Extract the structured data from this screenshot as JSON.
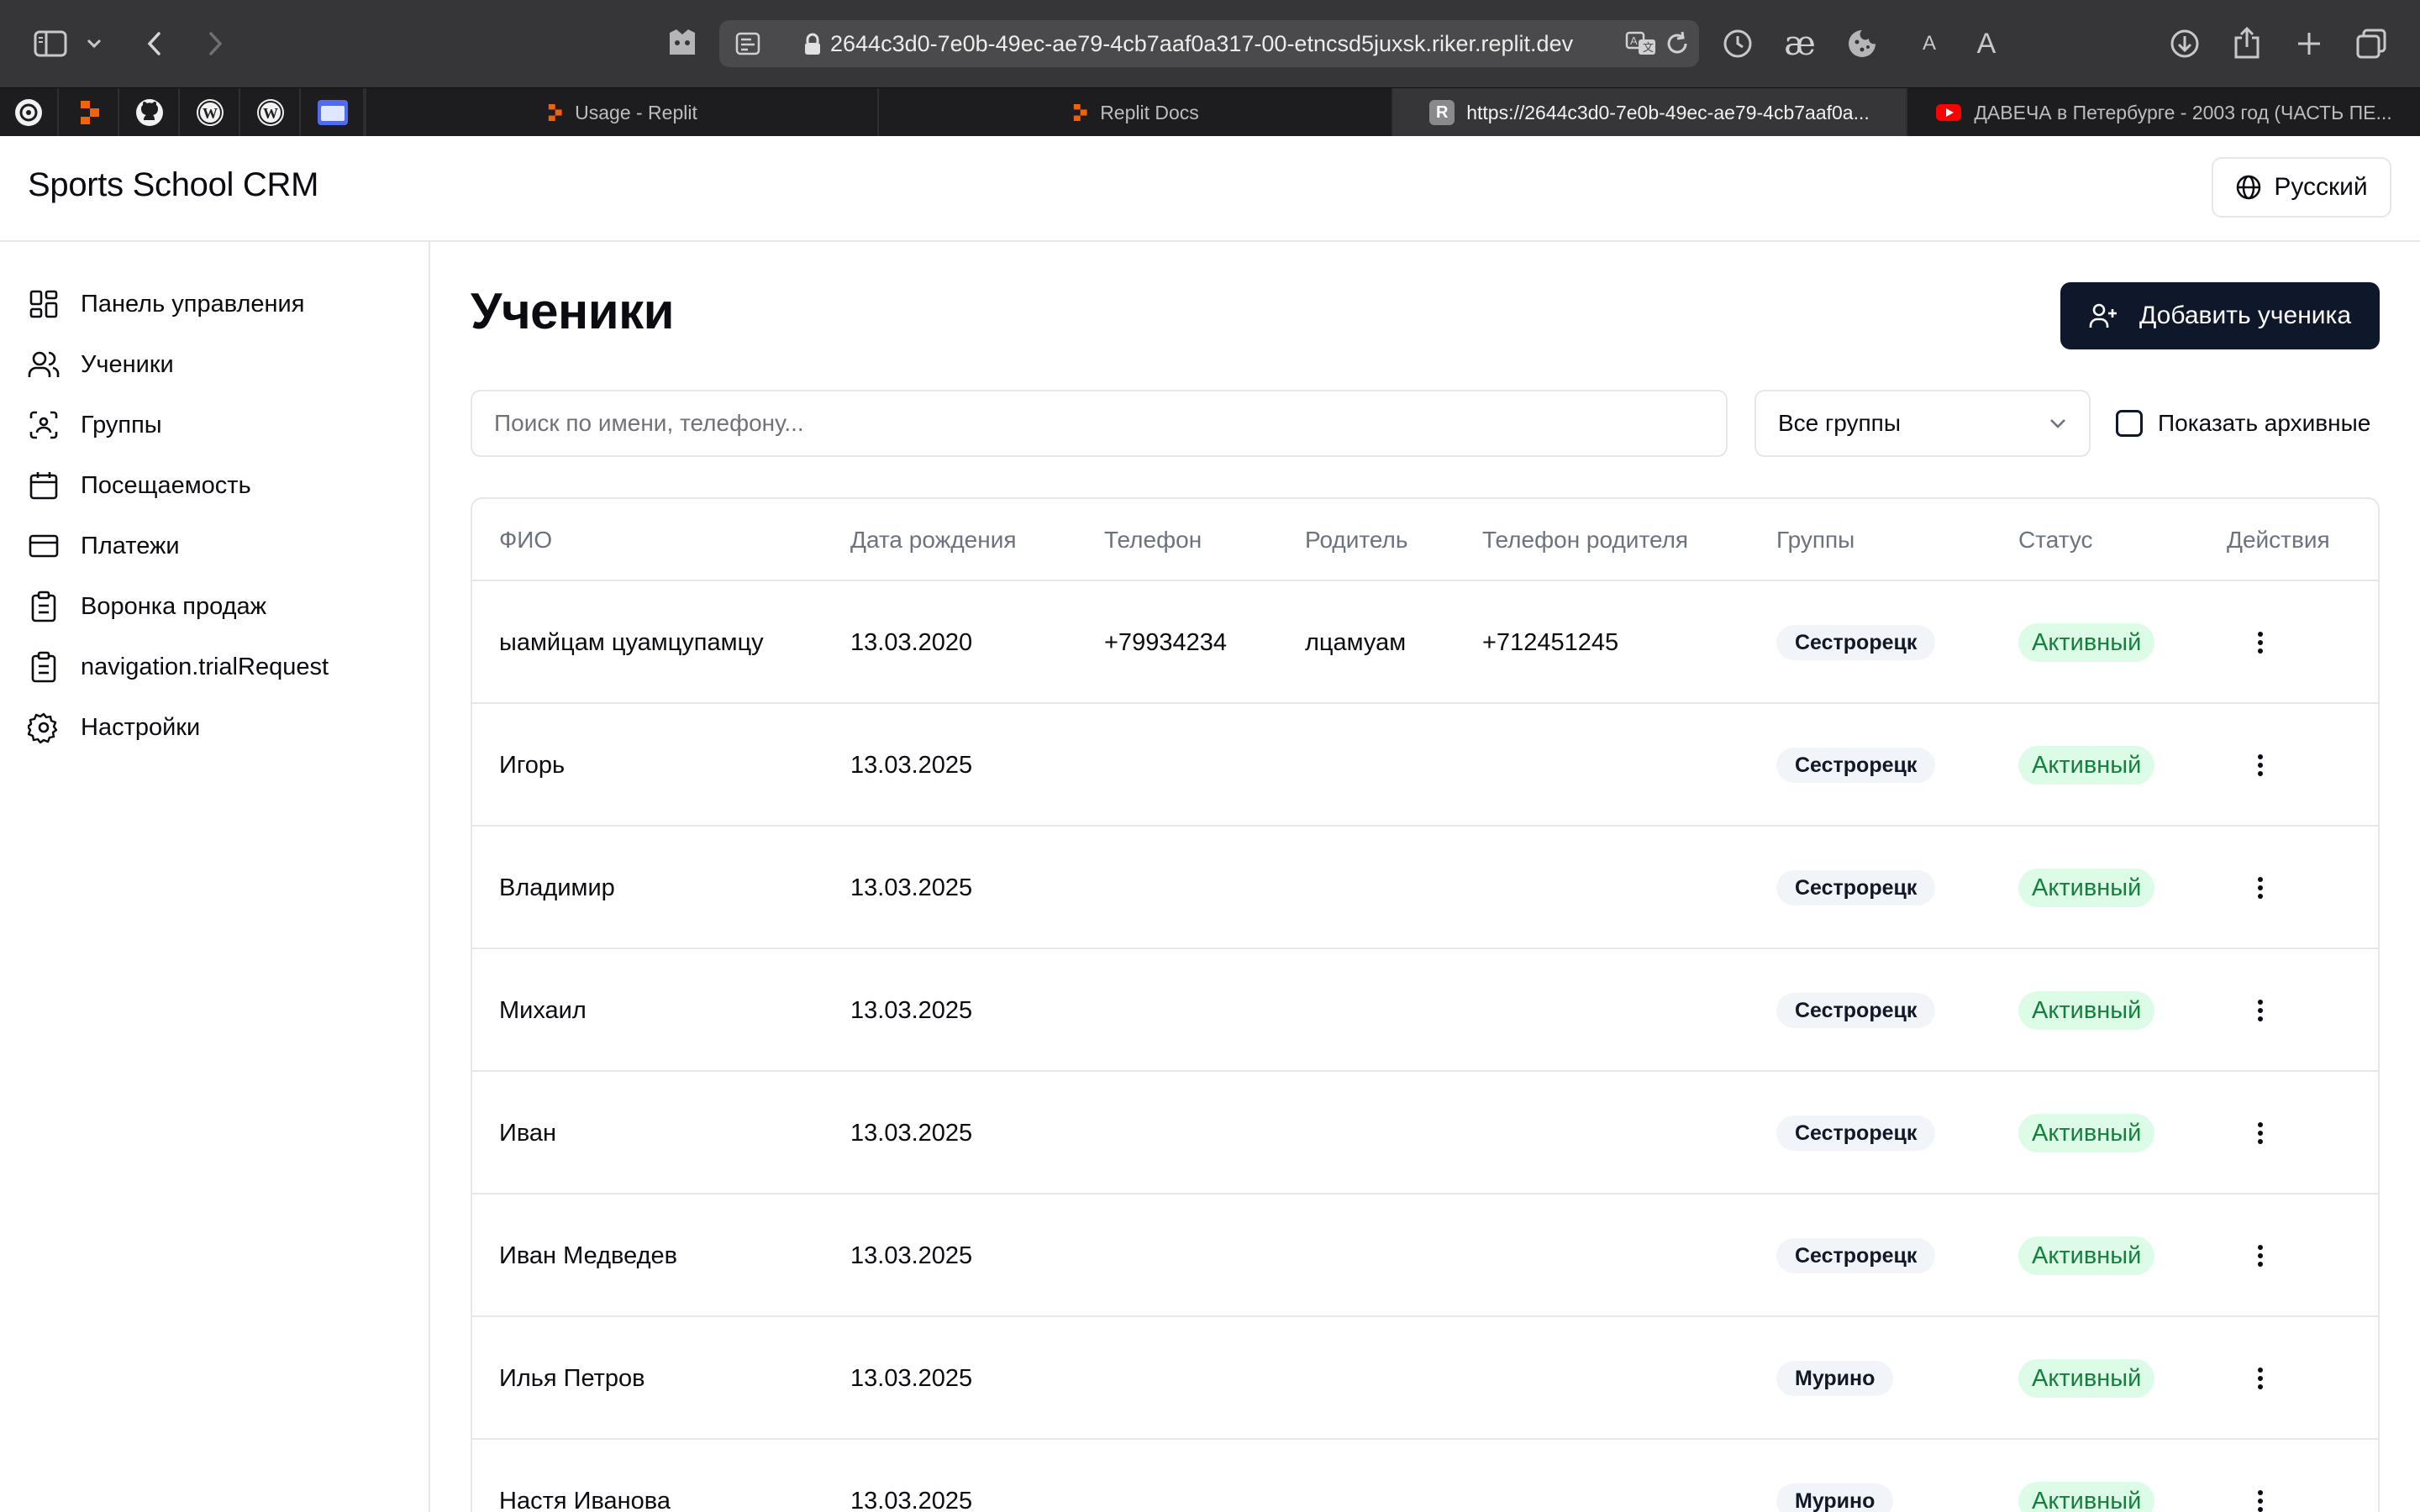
{
  "browser": {
    "url": "2644c3d0-7e0b-49ec-ae79-4cb7aaf0a317-00-etncsd5juxsk.riker.replit.dev",
    "reader_small_a": "A",
    "reader_large_a": "A",
    "ae_glyph": "æ",
    "tabs": [
      {
        "label": "Usage - Replit",
        "icon": "replit-icon"
      },
      {
        "label": "Replit Docs",
        "icon": "replit-icon"
      },
      {
        "label": "https://2644c3d0-7e0b-49ec-ae79-4cb7aaf0a...",
        "icon": "r-letter-icon",
        "icon_letter": "R",
        "active": true
      },
      {
        "label": "ДАВЕЧА в Петербурге - 2003 год (ЧАСТЬ ПЕ...",
        "icon": "youtube-icon"
      }
    ],
    "pinned_favicons": [
      "openai-icon",
      "replit-icon",
      "github-icon",
      "wordpress-icon",
      "wordpress-icon",
      "folder-icon"
    ]
  },
  "app": {
    "title": "Sports School CRM",
    "language": "Русский"
  },
  "sidebar": {
    "items": [
      {
        "label": "Панель управления",
        "icon": "dashboard-icon"
      },
      {
        "label": "Ученики",
        "icon": "users-icon"
      },
      {
        "label": "Группы",
        "icon": "groups-icon"
      },
      {
        "label": "Посещаемость",
        "icon": "calendar-icon"
      },
      {
        "label": "Платежи",
        "icon": "credit-card-icon"
      },
      {
        "label": "Воронка продаж",
        "icon": "clipboard-icon"
      },
      {
        "label": "navigation.trialRequest",
        "icon": "clipboard-icon"
      },
      {
        "label": "Настройки",
        "icon": "gear-icon"
      }
    ]
  },
  "main": {
    "title": "Ученики",
    "add_button": "Добавить ученика",
    "search_placeholder": "Поиск по имени, телефону...",
    "group_filter": "Все группы",
    "show_archived": "Показать архивные",
    "columns": [
      "ФИО",
      "Дата рождения",
      "Телефон",
      "Родитель",
      "Телефон родителя",
      "Группы",
      "Статус",
      "Действия"
    ],
    "rows": [
      {
        "name": "ыамйцам цуамцупамцу",
        "birth": "13.03.2020",
        "phone": "+79934234",
        "parent": "лцамуам",
        "parent_phone": "+712451245",
        "group": "Сестрорецк",
        "status": "Активный"
      },
      {
        "name": "Игорь",
        "birth": "13.03.2025",
        "phone": "",
        "parent": "",
        "parent_phone": "",
        "group": "Сестрорецк",
        "status": "Активный"
      },
      {
        "name": "Владимир",
        "birth": "13.03.2025",
        "phone": "",
        "parent": "",
        "parent_phone": "",
        "group": "Сестрорецк",
        "status": "Активный"
      },
      {
        "name": "Михаил",
        "birth": "13.03.2025",
        "phone": "",
        "parent": "",
        "parent_phone": "",
        "group": "Сестрорецк",
        "status": "Активный"
      },
      {
        "name": "Иван",
        "birth": "13.03.2025",
        "phone": "",
        "parent": "",
        "parent_phone": "",
        "group": "Сестрорецк",
        "status": "Активный"
      },
      {
        "name": "Иван Медведев",
        "birth": "13.03.2025",
        "phone": "",
        "parent": "",
        "parent_phone": "",
        "group": "Сестрорецк",
        "status": "Активный"
      },
      {
        "name": "Илья Петров",
        "birth": "13.03.2025",
        "phone": "",
        "parent": "",
        "parent_phone": "",
        "group": "Мурино",
        "status": "Активный"
      },
      {
        "name": "Настя Иванова",
        "birth": "13.03.2025",
        "phone": "",
        "parent": "",
        "parent_phone": "",
        "group": "Мурино",
        "status": "Активный"
      }
    ]
  },
  "colors": {
    "primary": "#0f172a",
    "status_bg": "#dcfce7",
    "status_text": "#15803d",
    "badge_bg": "#f1f5f9",
    "border": "#e5e7eb",
    "chrome": "#363638"
  }
}
